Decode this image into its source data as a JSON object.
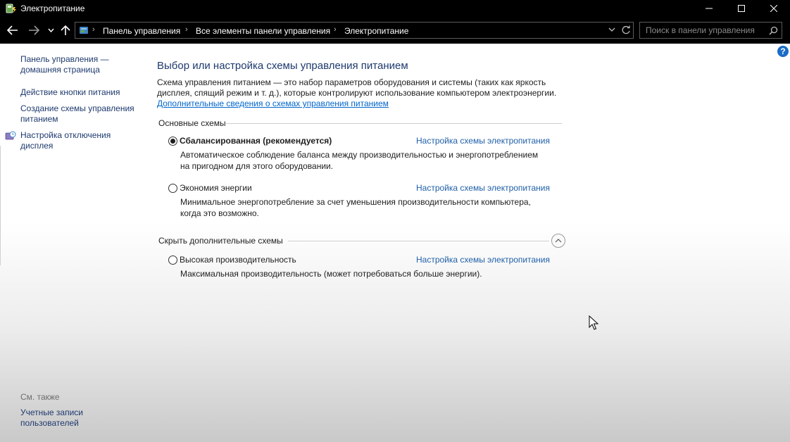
{
  "window": {
    "title": "Электропитание"
  },
  "address": {
    "breadcrumbs": [
      "Панель управления",
      "Все элементы панели управления",
      "Электропитание"
    ]
  },
  "search": {
    "placeholder": "Поиск в панели управления"
  },
  "sidebar": {
    "home_line1": "Панель управления —",
    "home_line2": "домашняя страница",
    "power_buttons": "Действие кнопки питания",
    "create_plan_line1": "Создание схемы управления",
    "create_plan_line2": "питанием",
    "display_off_line1": "Настройка отключения",
    "display_off_line2": "дисплея",
    "see_also": "См. также",
    "accounts_line1": "Учетные записи",
    "accounts_line2": "пользователей"
  },
  "main": {
    "title": "Выбор или настройка схемы управления питанием",
    "desc_line1": "Схема управления питанием — это набор параметров оборудования и системы (таких как яркость",
    "desc_line2": "дисплея, спящий режим и т. д.), которые контролируют использование компьютером электроэнергии.",
    "more_link": "Дополнительные сведения о схемах управления питанием",
    "basic_group": "Основные схемы",
    "hidden_group": "Скрыть дополнительные схемы",
    "settings_link": "Настройка схемы электропитания",
    "plans": [
      {
        "name": "Сбалансированная (рекомендуется)",
        "desc_line1": "Автоматическое соблюдение баланса между производительностью и энергопотреблением",
        "desc_line2": "на пригодном для этого оборудовании.",
        "selected": true
      },
      {
        "name": "Экономия энергии",
        "desc_line1": "Минимальное энергопотребление за счет уменьшения производительности компьютера,",
        "desc_line2": "когда это возможно.",
        "selected": false
      },
      {
        "name": "Высокая производительность",
        "desc_line1": "Максимальная производительность (может потребоваться больше энергии).",
        "selected": false
      }
    ]
  },
  "colors": {
    "link": "#1f5fa8",
    "heading": "#1e3a6e",
    "titlebar": "#000000"
  }
}
